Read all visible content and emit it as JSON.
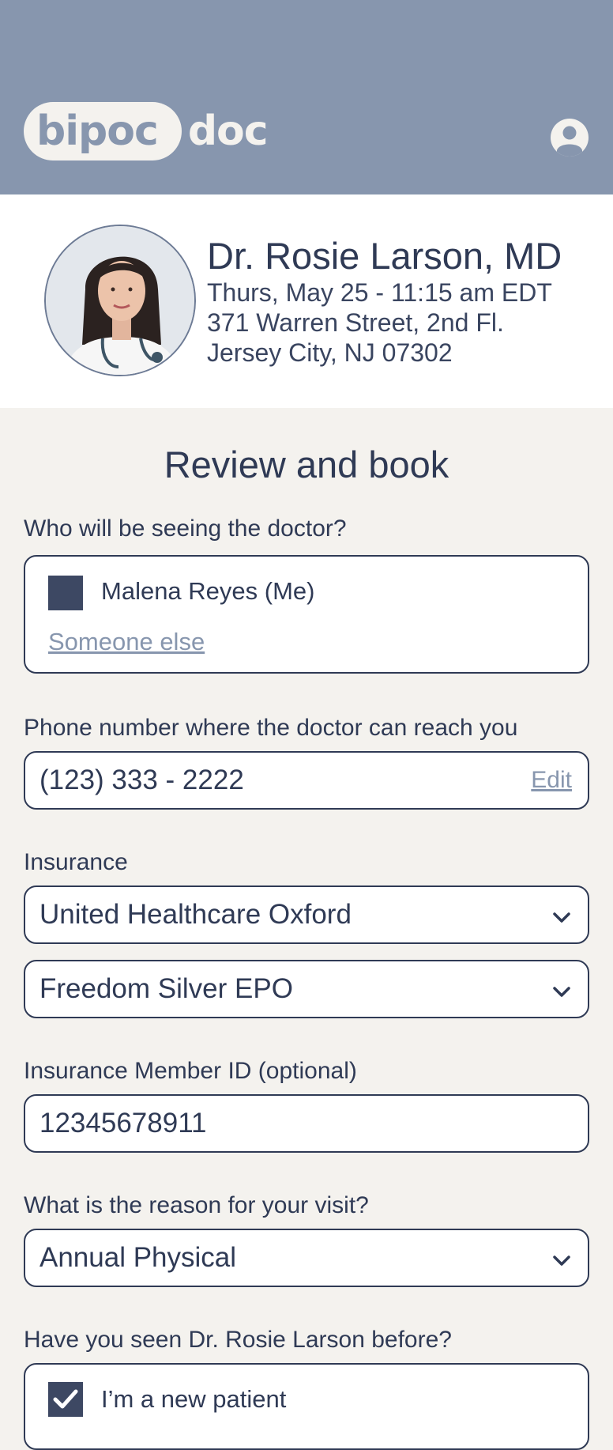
{
  "header": {
    "logo_pill_text": "bipoc",
    "logo_rest_text": "doc",
    "profile_icon": "user-circle-icon",
    "bg_color": "#8796ae"
  },
  "doctor": {
    "name": "Dr. Rosie Larson, MD",
    "datetime": "Thurs, May 25 - 11:15 am EDT",
    "address_line1": "371 Warren Street, 2nd Fl.",
    "address_line2": "Jersey City, NJ 07302"
  },
  "page_title": "Review and book",
  "who": {
    "label": "Who will be seeing the doctor?",
    "selected": "Malena Reyes (Me)",
    "other_link": "Someone else"
  },
  "phone": {
    "label": "Phone number where the doctor can reach you",
    "value": "(123) 333 - 2222",
    "edit_label": "Edit"
  },
  "insurance": {
    "label": "Insurance",
    "carrier": "United Healthcare Oxford",
    "plan": "Freedom Silver EPO"
  },
  "member_id": {
    "label": "Insurance Member ID (optional)",
    "value": "12345678911"
  },
  "reason": {
    "label": "What is the reason for your visit?",
    "value": "Annual Physical"
  },
  "seen_before": {
    "label": "Have you seen Dr. Rosie Larson before?",
    "option": "I’m a new patient",
    "checked": true
  },
  "colors": {
    "accent": "#8796ae",
    "text": "#2f3a55",
    "background": "#f4f2ee"
  }
}
